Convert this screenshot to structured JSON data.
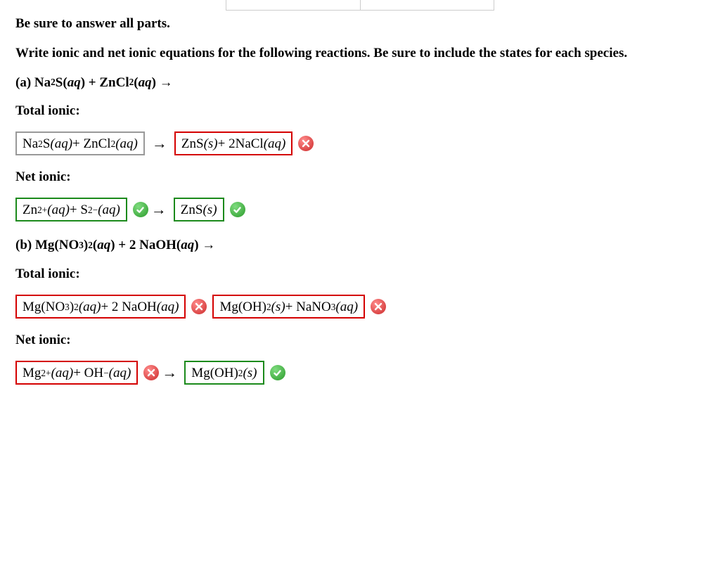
{
  "instr1": "Be sure to answer all parts.",
  "instr2": "Write ionic and net ionic equations for the following reactions. Be sure to include the states for each species.",
  "partA": {
    "heading_prefix": "(a) ",
    "reaction_html": "Na<sub>2</sub>S(<i>aq</i>) + ZnCl<sub>2</sub>(<i>aq</i>) →",
    "total_label": "Total ionic:",
    "net_label": "Net ionic:",
    "total_left": "Na<sub>2</sub>S <i>(aq)</i> + ZnCl<sub>2</sub> <i>(aq)</i>",
    "total_right": "ZnS <i>(s)</i> + 2NaCl <i>(aq)</i>",
    "net_left": "Zn<sup>2+</sup> <i>(aq)</i> + S<sup>2−</sup> <i>(aq)</i>",
    "net_right": "ZnS <i>(s)</i>"
  },
  "partB": {
    "heading_prefix": "(b) ",
    "reaction_html": "Mg(NO<sub>3</sub>)<sub>2</sub>(<i>aq</i>) + 2 NaOH(<i>aq</i>) →",
    "total_label": "Total ionic:",
    "net_label": "Net ionic:",
    "total_left": "Mg(NO<sub>3</sub>)<sub>2</sub> <i>(aq)</i> + 2 NaOH <i>(aq)</i>",
    "total_right": "Mg(OH)<sub>2</sub> <i>(s)</i> + NaNO<sub>3</sub> <i>(aq)</i>",
    "net_left": "Mg<sup>2+</sup> <i>(aq)</i> + OH<sup>−</sup> <i>(aq)</i>",
    "net_right": "Mg(OH)<sub>2</sub> <i>(s)</i>"
  },
  "icons": {
    "arrow": "→"
  }
}
